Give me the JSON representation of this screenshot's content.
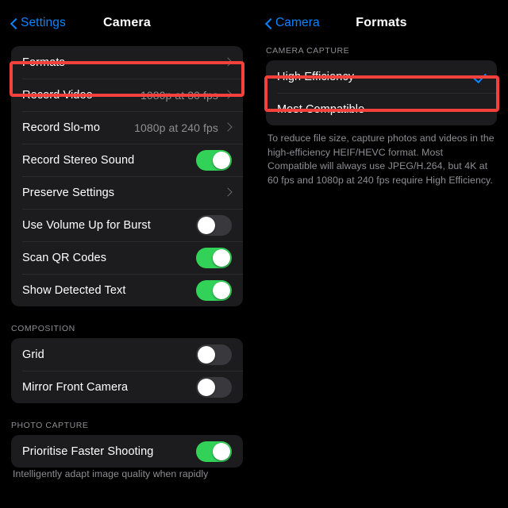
{
  "left": {
    "nav": {
      "back_label": "Settings",
      "title": "Camera"
    },
    "groups": [
      {
        "header": "",
        "rows": [
          {
            "label": "Formats",
            "type": "disclosure",
            "value": "",
            "highlighted": true
          },
          {
            "label": "Record Video",
            "type": "disclosure",
            "value": "1080p at 30 fps"
          },
          {
            "label": "Record Slo-mo",
            "type": "disclosure",
            "value": "1080p at 240 fps"
          },
          {
            "label": "Record Stereo Sound",
            "type": "toggle",
            "on": true
          },
          {
            "label": "Preserve Settings",
            "type": "disclosure",
            "value": ""
          },
          {
            "label": "Use Volume Up for Burst",
            "type": "toggle",
            "on": false
          },
          {
            "label": "Scan QR Codes",
            "type": "toggle",
            "on": true
          },
          {
            "label": "Show Detected Text",
            "type": "toggle",
            "on": true
          }
        ]
      },
      {
        "header": "COMPOSITION",
        "rows": [
          {
            "label": "Grid",
            "type": "toggle",
            "on": false
          },
          {
            "label": "Mirror Front Camera",
            "type": "toggle",
            "on": false
          }
        ]
      },
      {
        "header": "PHOTO CAPTURE",
        "rows": [
          {
            "label": "Prioritise Faster Shooting",
            "type": "toggle",
            "on": true
          }
        ]
      }
    ],
    "clipped_footnote": "Intelligently adapt image quality when rapidly"
  },
  "right": {
    "nav": {
      "back_label": "Camera",
      "title": "Formats"
    },
    "section_header": "CAMERA CAPTURE",
    "options": [
      {
        "label": "High Efficiency",
        "selected": true,
        "highlighted": true
      },
      {
        "label": "Most Compatible",
        "selected": false,
        "highlighted": false
      }
    ],
    "footnote": "To reduce file size, capture photos and videos in the high-efficiency HEIF/HEVC format. Most Compatible will always use JPEG/H.264, but 4K at 60 fps and 1080p at 240 fps require High Efficiency."
  },
  "colors": {
    "accent_blue": "#0a84ff",
    "toggle_on_green": "#32d158",
    "toggle_off_gray": "#39393d",
    "highlight_red": "#f4413b",
    "row_background": "#1c1c1e",
    "page_background": "#000000",
    "secondary_text": "#8e8e93"
  }
}
